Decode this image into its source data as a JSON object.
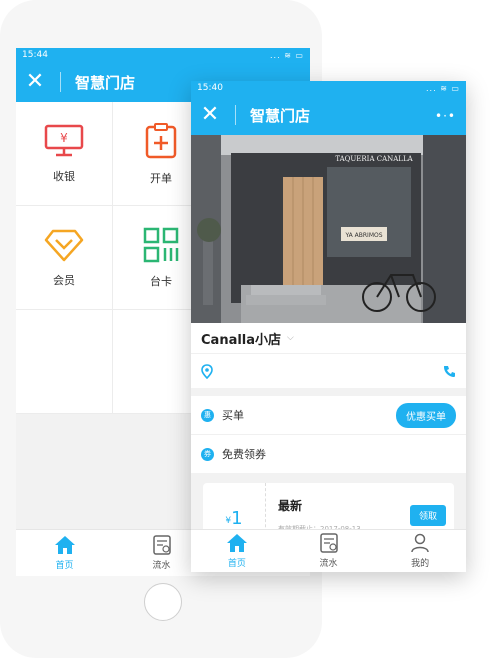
{
  "back": {
    "status": {
      "time": "15:44",
      "icons": "... ≋ ▭"
    },
    "header": {
      "title": "智慧门店"
    },
    "grid": [
      {
        "label": "收银",
        "icon": "cashier-monitor-icon",
        "color": "#e8484b"
      },
      {
        "label": "开单",
        "icon": "order-clipboard-icon",
        "color": "#f05a28"
      },
      {
        "label": "",
        "icon": "",
        "color": ""
      },
      {
        "label": "会员",
        "icon": "member-diamond-icon",
        "color": "#f5a623"
      },
      {
        "label": "台卡",
        "icon": "table-card-qr-icon",
        "color": "#2bb673"
      },
      {
        "label": "",
        "icon": "",
        "color": ""
      },
      {
        "label": "",
        "icon": "",
        "color": ""
      },
      {
        "label": "",
        "icon": "",
        "color": ""
      },
      {
        "label": "",
        "icon": "",
        "color": ""
      }
    ],
    "tabs": [
      {
        "label": "首页",
        "icon": "home-icon",
        "active": true
      },
      {
        "label": "流水",
        "icon": "statement-icon",
        "active": false
      }
    ]
  },
  "front": {
    "status": {
      "time": "15:40",
      "icons": "... ≋ ▭"
    },
    "header": {
      "title": "智慧门店"
    },
    "photo": {
      "sign": "TAQUERIA CANALLA",
      "door_sign": "YA ABRIMOS"
    },
    "store": {
      "name": "Canalla小店"
    },
    "rows": {
      "buy": {
        "badge": "惠",
        "label": "买单",
        "button": "优惠买单"
      },
      "coupon": {
        "badge": "券",
        "label": "免费领券"
      }
    },
    "coupon": {
      "symbol": "¥",
      "amount": "1",
      "title": "最新",
      "date": "有效期截止：2017-08-13",
      "button": "领取"
    },
    "tabs": [
      {
        "label": "首页",
        "icon": "home-icon",
        "active": true
      },
      {
        "label": "流水",
        "icon": "statement-icon",
        "active": false
      },
      {
        "label": "我的",
        "icon": "profile-icon",
        "active": false
      }
    ],
    "accent": "#1fb1f0"
  }
}
